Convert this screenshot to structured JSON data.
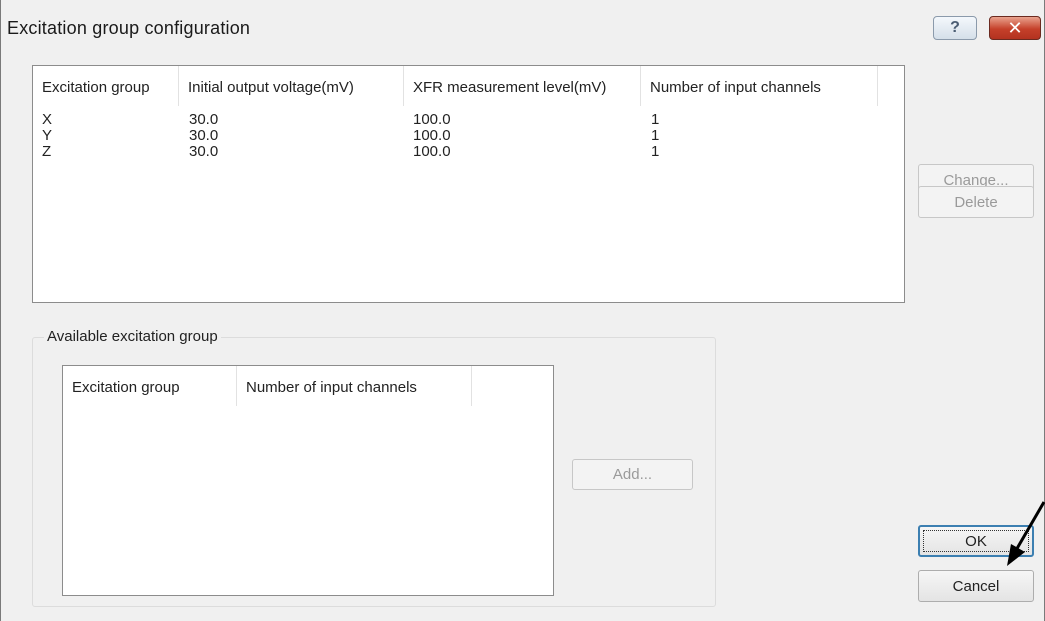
{
  "window": {
    "title": "Excitation group configuration",
    "help_glyph": "?",
    "close_glyph": "✕"
  },
  "configured_list": {
    "columns": [
      "Excitation group",
      "Initial output voltage(mV)",
      "XFR measurement level(mV)",
      "Number of input channels"
    ],
    "rows": [
      [
        "X",
        "30.0",
        "100.0",
        "1"
      ],
      [
        "Y",
        "30.0",
        "100.0",
        "1"
      ],
      [
        "Z",
        "30.0",
        "100.0",
        "1"
      ]
    ]
  },
  "buttons": {
    "change": "Change...",
    "delete": "Delete",
    "add": "Add...",
    "ok": "OK",
    "cancel": "Cancel"
  },
  "available_group": {
    "label": "Available excitation group",
    "columns": [
      "Excitation group",
      "Number of input channels"
    ]
  },
  "icons": {
    "help": "help-icon",
    "close": "close-icon",
    "annotation_arrow": "pointer-arrow-icon"
  },
  "colors": {
    "close_button": "#c5402a",
    "default_button_border": "#3c7fb1"
  }
}
